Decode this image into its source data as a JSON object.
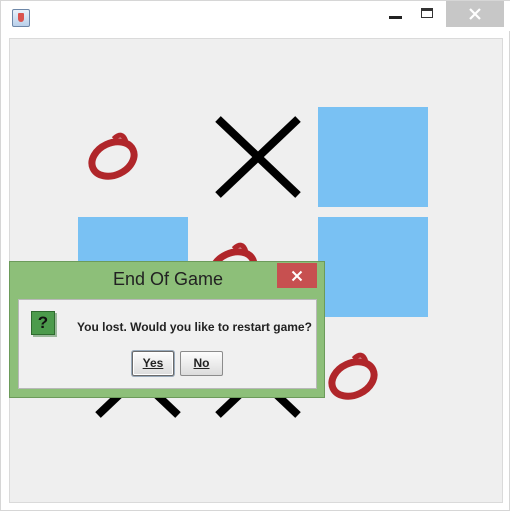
{
  "window": {
    "app_icon": "java-cup-icon",
    "controls": [
      "minimize-icon",
      "maximize-icon",
      "close-icon"
    ]
  },
  "board": {
    "cells": [
      {
        "row": 0,
        "col": 0,
        "mark": "O"
      },
      {
        "row": 0,
        "col": 1,
        "mark": "X"
      },
      {
        "row": 0,
        "col": 2,
        "mark": "empty"
      },
      {
        "row": 1,
        "col": 0,
        "mark": "empty"
      },
      {
        "row": 1,
        "col": 1,
        "mark": "O"
      },
      {
        "row": 1,
        "col": 2,
        "mark": "empty"
      },
      {
        "row": 2,
        "col": 0,
        "mark": "X"
      },
      {
        "row": 2,
        "col": 1,
        "mark": "X"
      },
      {
        "row": 2,
        "col": 2,
        "mark": "O"
      }
    ],
    "colors": {
      "empty_cell": "#79c1f3",
      "x_mark": "#000000",
      "o_mark": "#b0262a"
    }
  },
  "dialog": {
    "title": "End Of Game",
    "icon": "question-icon",
    "icon_glyph": "?",
    "message": "You lost. Would you like to restart game?",
    "yes_label": "Yes",
    "no_label": "No",
    "colors": {
      "frame": "#8dbf79",
      "close": "#c75050"
    }
  }
}
